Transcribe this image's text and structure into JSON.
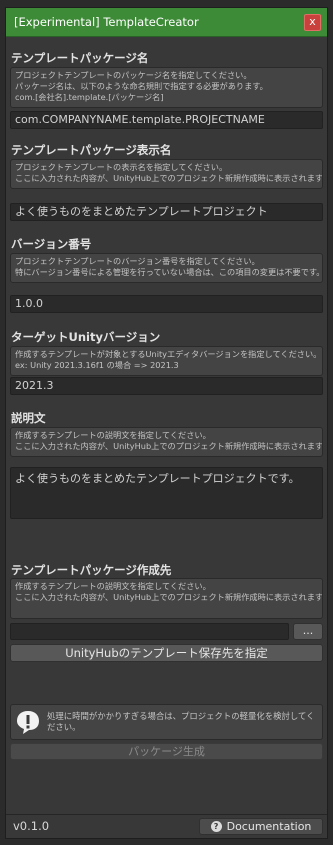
{
  "window": {
    "title": "[Experimental] TemplateCreator",
    "close_label": "x"
  },
  "package_name": {
    "label": "テンプレートパッケージ名",
    "help": [
      "プロジェクトテンプレートのパッケージ名を指定してください。",
      "パッケージ名は、以下のような命名規則で指定する必要があります。",
      "com.[会社名].template.[パッケージ名]"
    ],
    "value": "com.COMPANYNAME.template.PROJECTNAME"
  },
  "display_name": {
    "label": "テンプレートパッケージ表示名",
    "help": [
      "プロジェクトテンプレートの表示名を指定してください。",
      "ここに入力された内容が、UnityHub上でのプロジェクト新規作成時に表示されます。"
    ],
    "value": "よく使うものをまとめたテンプレートプロジェクト"
  },
  "version": {
    "label": "バージョン番号",
    "help": [
      "プロジェクトテンプレートのバージョン番号を指定してください。",
      "特にバージョン番号による管理を行っていない場合は、この項目の変更は不要です。"
    ],
    "value": "1.0.0"
  },
  "unity_version": {
    "label": "ターゲットUnityバージョン",
    "help": [
      "作成するテンプレートが対象とするUnityエディタバージョンを指定してください。",
      "ex: Unity 2021.3.16f1 の場合 => 2021.3"
    ],
    "value": "2021.3"
  },
  "description": {
    "label": "説明文",
    "help": [
      "作成するテンプレートの説明文を指定してください。",
      "ここに入力された内容が、UnityHub上でのプロジェクト新規作成時に表示されます。"
    ],
    "value": "よく使うものをまとめたテンプレートプロジェクトです。"
  },
  "destination": {
    "label": "テンプレートパッケージ作成先",
    "help": [
      "作成するテンプレートの説明文を指定してください。",
      "ここに入力された内容が、UnityHub上でのプロジェクト新規作成時に表示されます。"
    ],
    "value": "",
    "browse_label": "...",
    "set_unityhub_label": "UnityHubのテンプレート保存先を指定"
  },
  "warning": {
    "icon": "warning-icon",
    "text": [
      "処理に時間がかかりすぎる場合は、プロジェクトの軽量化を検討してく",
      "ださい。"
    ]
  },
  "generate_label": "パッケージ生成",
  "footer": {
    "version": "v0.1.0",
    "docs_label": "Documentation",
    "docs_icon": "help-icon"
  },
  "colors": {
    "titlebar": "#3d8a37",
    "close": "#c8413c",
    "background": "#383838"
  }
}
